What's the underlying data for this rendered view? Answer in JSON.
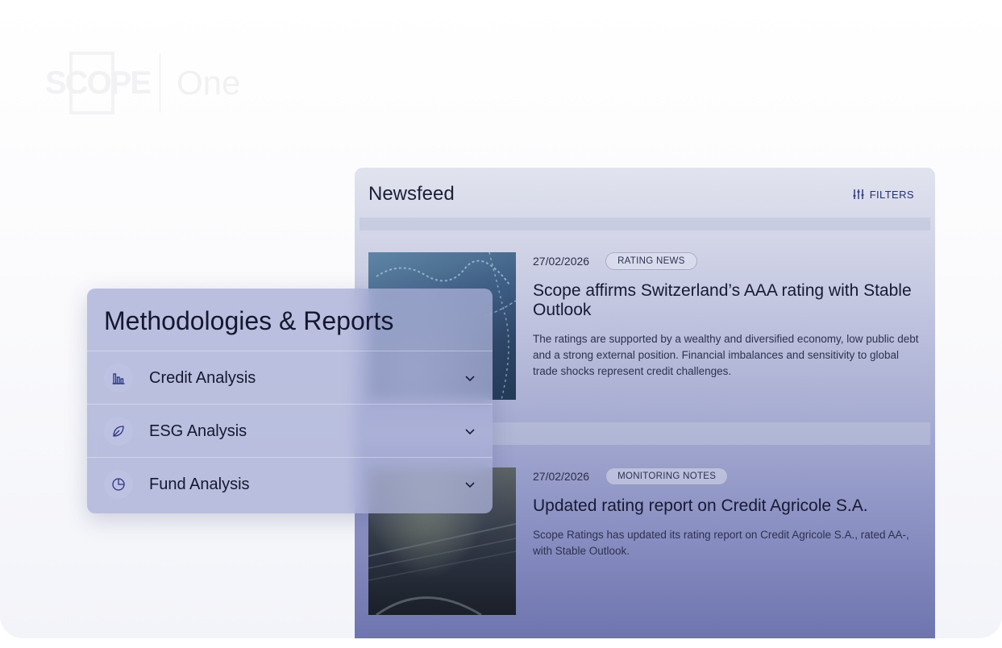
{
  "logo": {
    "mark": "SCOPE",
    "product": "One"
  },
  "newsfeed": {
    "title": "Newsfeed",
    "filters_label": "FILTERS",
    "items": [
      {
        "date": "27/02/2026",
        "tag": "RATING NEWS",
        "title": "Scope affirms Switzerland’s AAA rating with Stable Outlook",
        "summary": "The ratings are supported by a wealthy and diversified economy, low public debt and a strong external position. Financial imbalances and sensitivity to global trade shocks represent credit challenges."
      },
      {
        "date": "27/02/2026",
        "tag": "MONITORING NOTES",
        "title": "Updated rating report on Credit Agricole S.A.",
        "summary": "Scope Ratings has updated its rating report on Credit Agricole S.A., rated AA-, with Stable Outlook."
      }
    ]
  },
  "methodologies": {
    "title": "Methodologies & Reports",
    "items": [
      {
        "label": "Credit Analysis",
        "icon": "bar-chart-icon"
      },
      {
        "label": "ESG Analysis",
        "icon": "leaf-icon"
      },
      {
        "label": "Fund Analysis",
        "icon": "pie-chart-icon"
      }
    ]
  },
  "colors": {
    "accent": "#24307a",
    "card_bg": "#a8aed6",
    "feed_bottom": "#6b71ac"
  }
}
